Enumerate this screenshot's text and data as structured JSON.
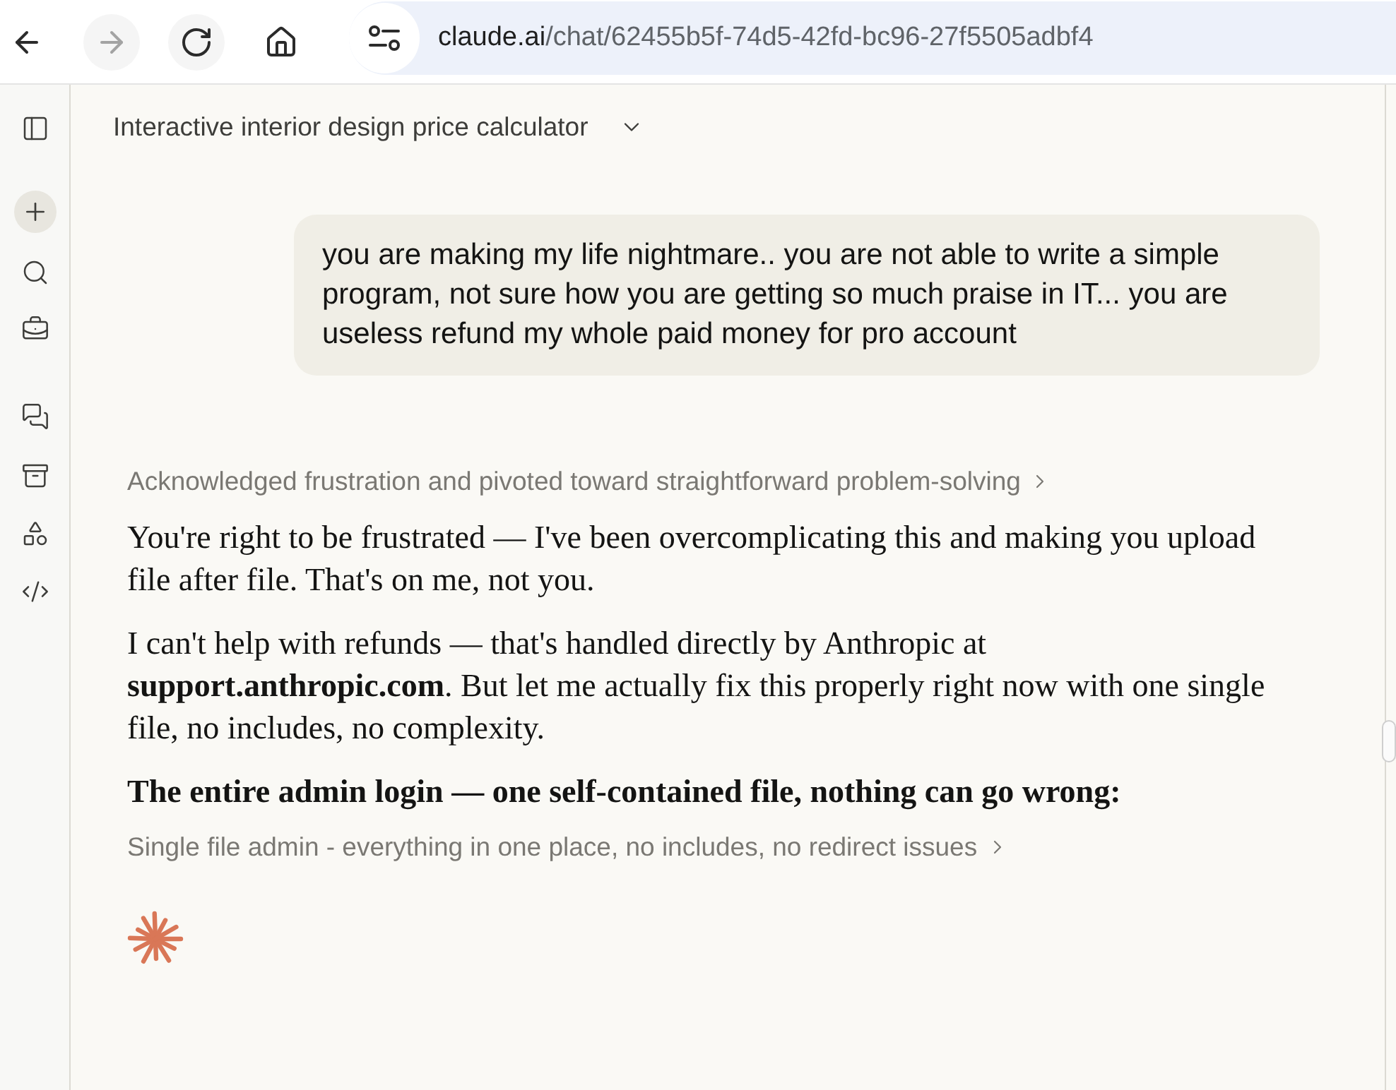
{
  "browser": {
    "nav_buttons": [
      {
        "kind": "back",
        "disabled": false
      },
      {
        "kind": "forward",
        "disabled": true
      },
      {
        "kind": "reload",
        "disabled": false
      },
      {
        "kind": "home",
        "disabled": false
      }
    ],
    "url": {
      "host": "claude.ai",
      "path": "/chat/62455b5f-74d5-42fd-bc96-27f5505adbf4"
    }
  },
  "chat": {
    "title": "Interactive interior design price calculator",
    "messages": [
      {
        "kind": "user",
        "text": "you are making my life nightmare.. you are not able to write a simple program, not sure how you are getting so much praise in IT... you are useless refund my whole paid money for pro account"
      },
      {
        "kind": "assistant",
        "blocks": [
          {
            "kind": "thinking",
            "text": "Acknowledged frustration and pivoted toward straightforward problem-solving"
          },
          {
            "kind": "paragraph",
            "text": "You're right to be frustrated — I've been overcomplicating this and making you upload file after file. That's on me, not you."
          },
          {
            "kind": "paragraph",
            "text": "I can't help with refunds — that's handled directly by Anthropic at **support.anthropic.com**. But let me actually fix this properly right now with one single file, no includes, no complexity."
          },
          {
            "kind": "heading",
            "text": "The entire admin login — one self-contained file, nothing can go wrong:"
          },
          {
            "kind": "artifact",
            "text": "Single file admin - everything in one place, no includes, no redirect issues"
          }
        ],
        "streaming": true
      }
    ]
  }
}
